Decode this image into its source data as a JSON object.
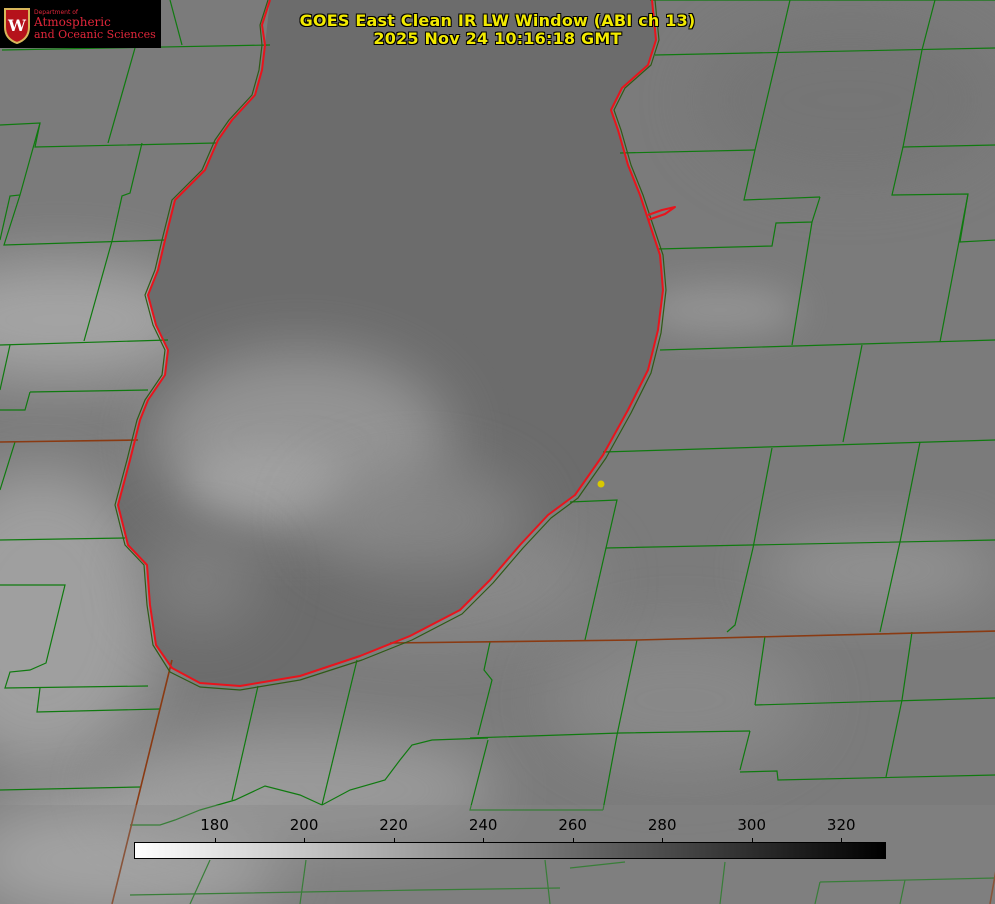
{
  "title": {
    "line1": "GOES East Clean IR LW Window (ABI ch 13)",
    "line2": "2025 Nov 24 10:16:18 GMT"
  },
  "logo": {
    "crest_letter": "W",
    "department": "Department of",
    "name_line1": "Atmospheric",
    "name_line2": "and Oceanic Sciences"
  },
  "colorbar": {
    "range": [
      162,
      330
    ],
    "ticks": [
      "180",
      "200",
      "220",
      "240",
      "260",
      "280",
      "300",
      "320"
    ],
    "color_low": "#ffffff",
    "color_high": "#000000"
  },
  "colors": {
    "county_lines": "#0f7a0f",
    "state_lines": "#8a3a12",
    "lake_outline": "#e8141c",
    "lake_fill": "#6c6c6c",
    "marker": "#d8c800"
  },
  "map": {
    "marker": "yellow-station-dot"
  }
}
